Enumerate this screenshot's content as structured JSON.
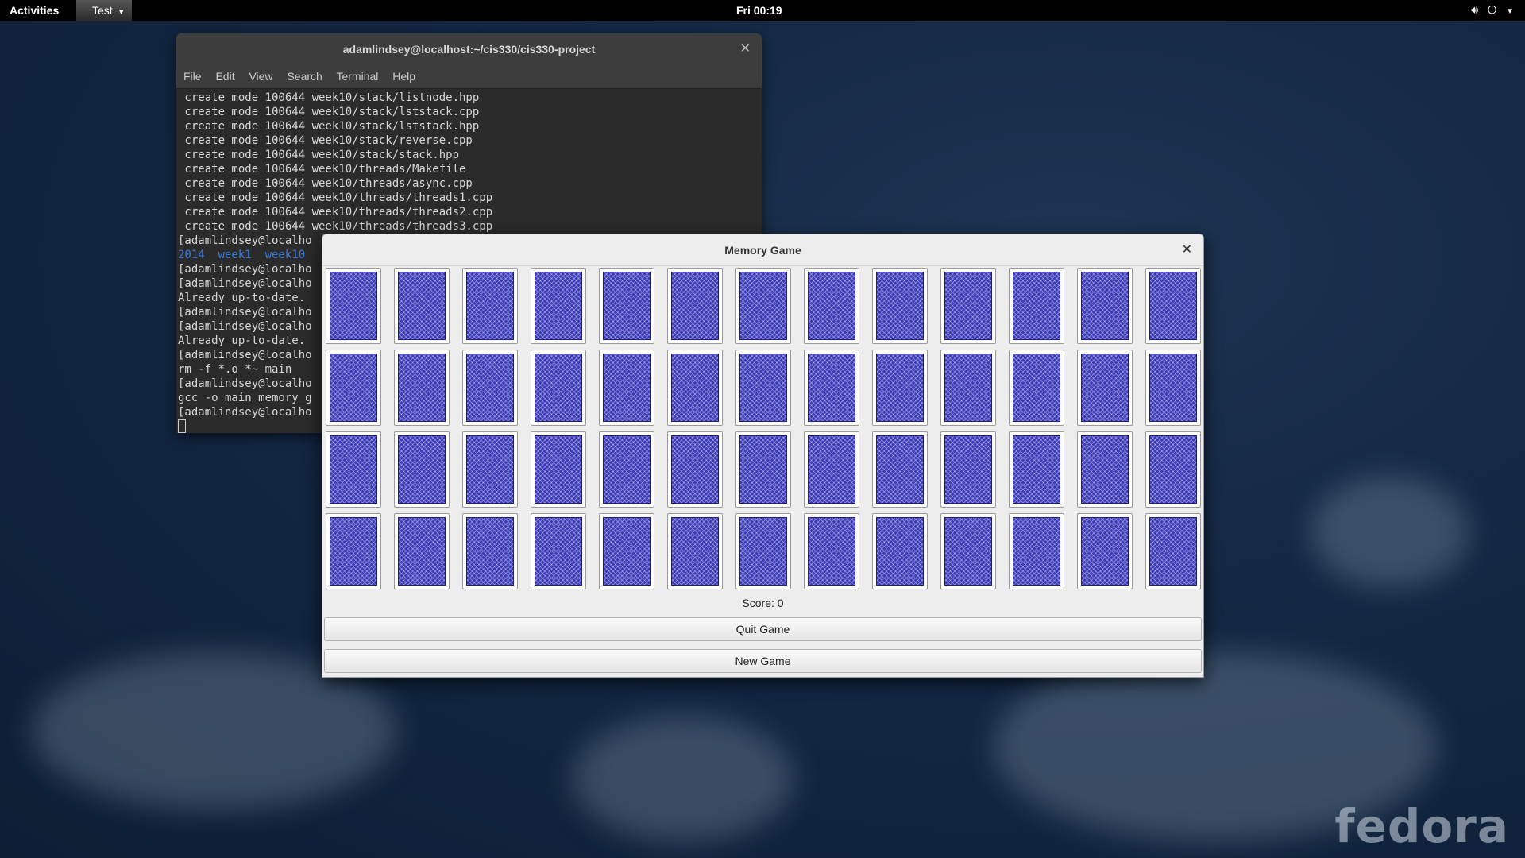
{
  "topbar": {
    "activities": "Activities",
    "app_menu": "Test",
    "clock": "Fri 00:19",
    "icons": [
      "volume-icon",
      "power-icon",
      "chevron-down-icon"
    ]
  },
  "terminal": {
    "title": "adamlindsey@localhost:~/cis330/cis330-project",
    "menu": [
      "File",
      "Edit",
      "View",
      "Search",
      "Terminal",
      "Help"
    ],
    "lines": [
      " create mode 100644 week10/stack/listnode.hpp",
      " create mode 100644 week10/stack/lststack.cpp",
      " create mode 100644 week10/stack/lststack.hpp",
      " create mode 100644 week10/stack/reverse.cpp",
      " create mode 100644 week10/stack/stack.hpp",
      " create mode 100644 week10/threads/Makefile",
      " create mode 100644 week10/threads/async.cpp",
      " create mode 100644 week10/threads/threads1.cpp",
      " create mode 100644 week10/threads/threads2.cpp",
      " create mode 100644 week10/threads/threads3.cpp",
      "[adamlindsey@localho",
      "2014  week1  week10",
      "[adamlindsey@localho",
      "[adamlindsey@localho",
      "Already up-to-date.",
      "[adamlindsey@localho",
      "[adamlindsey@localho",
      "Already up-to-date.",
      "[adamlindsey@localho",
      "rm -f *.o *~ main",
      "[adamlindsey@localho",
      "gcc -o main memory_g",
      "[adamlindsey@localho"
    ]
  },
  "game": {
    "title": "Memory Game",
    "rows": 4,
    "cols": 13,
    "score_label": "Score: 0",
    "quit_label": "Quit Game",
    "new_label": "New Game"
  },
  "desktop": {
    "watermark": "fedora"
  },
  "colors": {
    "card_back": "#3a3ab8",
    "terminal_bg": "#2b2b2b",
    "ls_dir_blue": "#3a7ad8"
  }
}
